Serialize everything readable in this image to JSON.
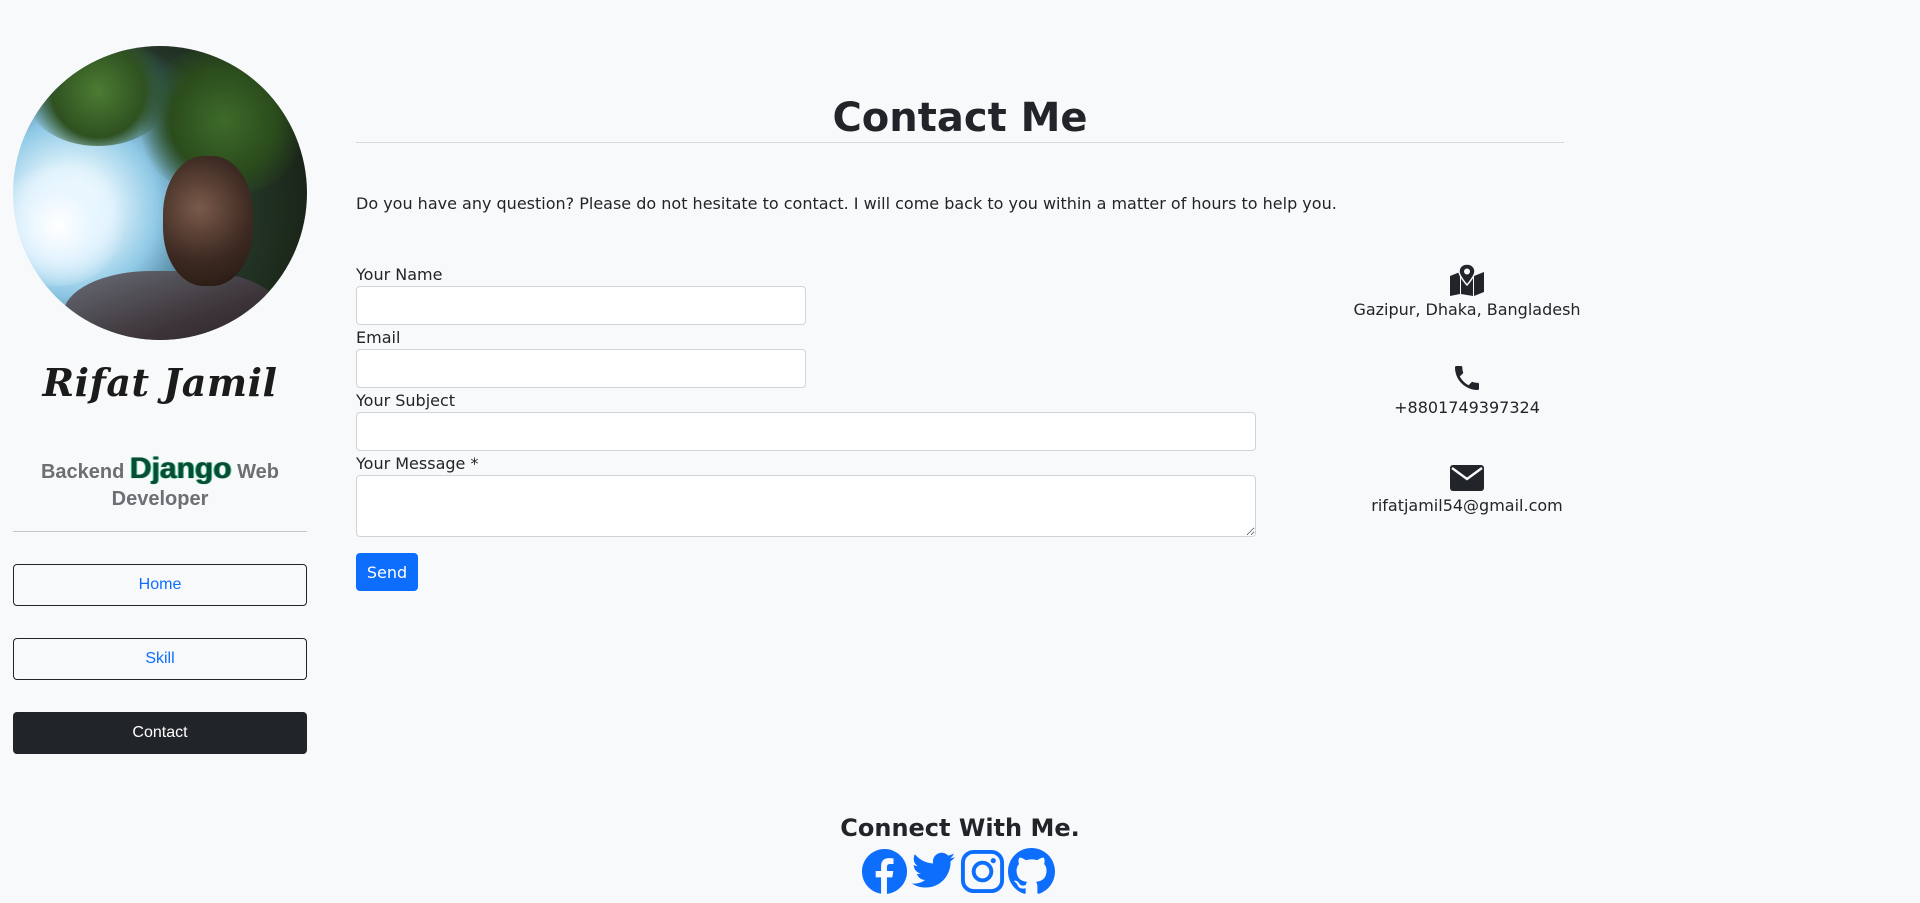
{
  "profile": {
    "name": "Rifat Jamil",
    "role_prefix": "Backend",
    "role_highlight": "Django",
    "role_suffix": "Web Developer"
  },
  "nav": {
    "items": [
      {
        "label": "Home",
        "active": false
      },
      {
        "label": "Skill",
        "active": false
      },
      {
        "label": "Contact",
        "active": true
      }
    ]
  },
  "main": {
    "title": "Contact Me",
    "intro": "Do you have any question? Please do not hesitate to contact. I will come back to you within a matter of hours to help you."
  },
  "form": {
    "name_label": "Your Name",
    "email_label": "Email",
    "subject_label": "Your Subject",
    "message_label": "Your Message *",
    "name_value": "",
    "email_value": "",
    "subject_value": "",
    "message_value": "",
    "send_label": "Send"
  },
  "info": {
    "address": "Gazipur, Dhaka, Bangladesh",
    "phone": "+8801749397324",
    "email": "rifatjamil54@gmail.com",
    "icons": [
      "map-pin-icon",
      "phone-icon",
      "envelope-icon"
    ]
  },
  "footer": {
    "heading": "Connect With Me.",
    "socials": [
      "facebook-icon",
      "twitter-icon",
      "instagram-icon",
      "github-icon"
    ]
  },
  "colors": {
    "background": "#f8f9fa",
    "primary": "#0d6efd",
    "dark": "#212529",
    "django_green": "#0c4b33"
  }
}
